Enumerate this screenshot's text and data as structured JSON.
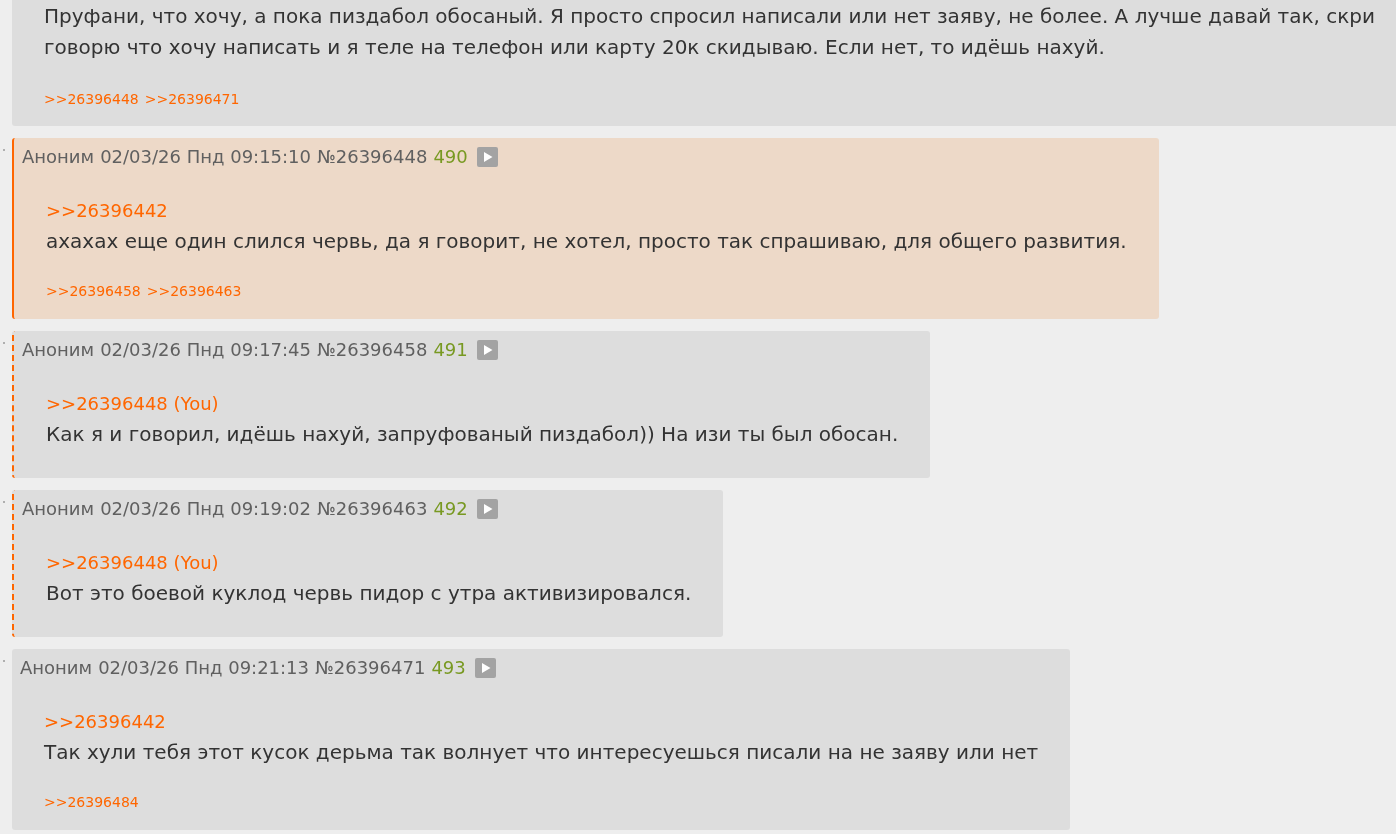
{
  "posts": [
    {
      "selected": false,
      "replies_to_you": false,
      "message_lines": [
        "Пруфани, что хочу, а пока пиздабол обосаный. Я просто спросил написали или нет заяву, не более. А лучше давай так, скри",
        "говорю что хочу написать и я теле на телефон или карту 20к скидываю. Если нет, то идёшь нахуй."
      ],
      "replies": [
        ">>26396448",
        ">>26396471"
      ]
    },
    {
      "selected": true,
      "replies_to_you": false,
      "author": "Аноним",
      "date": "02/03/26 Пнд 09:15:10",
      "number": "№26396448",
      "counter": "490",
      "quote": ">>26396442",
      "message_lines": [
        "ахахах еще один слился червь, да я говорит, не хотел, просто так спрашиваю, для общего развития."
      ],
      "replies": [
        ">>26396458",
        ">>26396463"
      ]
    },
    {
      "selected": false,
      "replies_to_you": true,
      "author": "Аноним",
      "date": "02/03/26 Пнд 09:17:45",
      "number": "№26396458",
      "counter": "491",
      "quote": ">>26396448 (You)",
      "message_lines": [
        "Как я и говорил, идёшь нахуй, запруфованый пиздабол)) На изи ты был обосан."
      ]
    },
    {
      "selected": false,
      "replies_to_you": true,
      "author": "Аноним",
      "date": "02/03/26 Пнд 09:19:02",
      "number": "№26396463",
      "counter": "492",
      "quote": ">>26396448 (You)",
      "message_lines": [
        "Вот это боевой куклод червь пидор с утра активизировался."
      ]
    },
    {
      "selected": false,
      "replies_to_you": false,
      "author": "Аноним",
      "date": "02/03/26 Пнд 09:21:13",
      "number": "№26396471",
      "counter": "493",
      "quote": ">>26396442",
      "message_lines": [
        "Так хули тебя этот кусок дерьма так волнует что интересуешься писали на не заяву или нет"
      ],
      "replies": [
        ">>26396484"
      ]
    }
  ]
}
